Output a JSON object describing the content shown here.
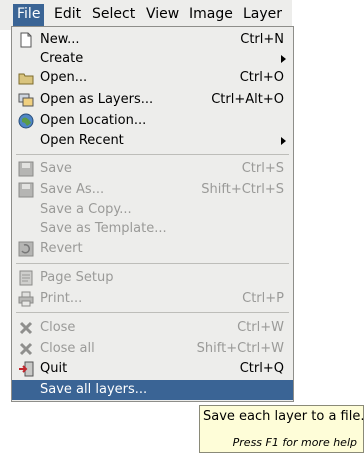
{
  "menubar": {
    "items": [
      {
        "label": "File",
        "active": true
      },
      {
        "label": "Edit"
      },
      {
        "label": "Select"
      },
      {
        "label": "View"
      },
      {
        "label": "Image"
      },
      {
        "label": "Layer"
      }
    ]
  },
  "menu": {
    "items": [
      {
        "label": "New...",
        "accel": "Ctrl+N",
        "icon": "new-image-icon"
      },
      {
        "label": "Create",
        "submenu": true
      },
      {
        "label": "Open...",
        "accel": "Ctrl+O",
        "icon": "folder-icon"
      },
      {
        "label": "Open as Layers...",
        "accel": "Ctrl+Alt+O",
        "icon": "layers-icon"
      },
      {
        "label": "Open Location...",
        "icon": "globe-icon"
      },
      {
        "label": "Open Recent",
        "submenu": true
      },
      {
        "label": "Save",
        "accel": "Ctrl+S",
        "icon": "floppy-icon",
        "disabled": true
      },
      {
        "label": "Save As...",
        "accel": "Shift+Ctrl+S",
        "icon": "floppy-icon",
        "disabled": true
      },
      {
        "label": "Save a Copy...",
        "disabled": true
      },
      {
        "label": "Save as Template...",
        "disabled": true
      },
      {
        "label": "Revert",
        "icon": "revert-icon",
        "disabled": true
      },
      {
        "label": "Page Setup",
        "icon": "page-setup-icon",
        "disabled": true
      },
      {
        "label": "Print...",
        "accel": "Ctrl+P",
        "icon": "printer-icon",
        "disabled": true
      },
      {
        "label": "Close",
        "accel": "Ctrl+W",
        "icon": "close-icon",
        "disabled": true
      },
      {
        "label": "Close all",
        "accel": "Shift+Ctrl+W",
        "icon": "close-icon",
        "disabled": true
      },
      {
        "label": "Quit",
        "accel": "Ctrl+Q",
        "icon": "quit-icon"
      },
      {
        "label": "Save all layers...",
        "highlighted": true
      }
    ]
  },
  "tooltip": {
    "text": "Save each layer to a file.",
    "help": "Press F1 for more help"
  },
  "colors": {
    "menu_bg": "#ededeb",
    "highlight": "#3a6495",
    "disabled_text": "#9a9a98",
    "tooltip_bg": "#fefdd8"
  }
}
